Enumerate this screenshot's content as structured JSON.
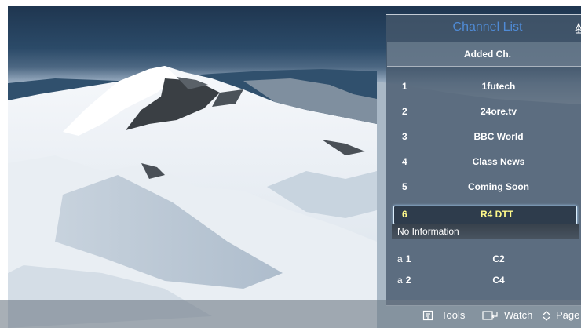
{
  "panel": {
    "title": "Channel List",
    "subtitle": "Added Ch.",
    "channels": [
      {
        "number": "1",
        "name": "1futech"
      },
      {
        "number": "2",
        "name": "24ore.tv"
      },
      {
        "number": "3",
        "name": "BBC World"
      },
      {
        "number": "4",
        "name": "Class News"
      },
      {
        "number": "5",
        "name": "Coming Soon"
      },
      {
        "number": "6",
        "name": "R4 DTT"
      },
      {
        "prefix": "a",
        "number": "1",
        "name": "C2"
      },
      {
        "prefix": "a",
        "number": "2",
        "name": "C4"
      }
    ],
    "info": "No Information",
    "selected_index": 5,
    "accent_color": "#4f8bd6",
    "selected_text_color": "#fff98a"
  },
  "hints": {
    "tools": "Tools",
    "watch": "Watch",
    "page": "Page"
  },
  "icons": [
    "pin-icon",
    "tools-icon",
    "watch-icon",
    "page-icon"
  ]
}
